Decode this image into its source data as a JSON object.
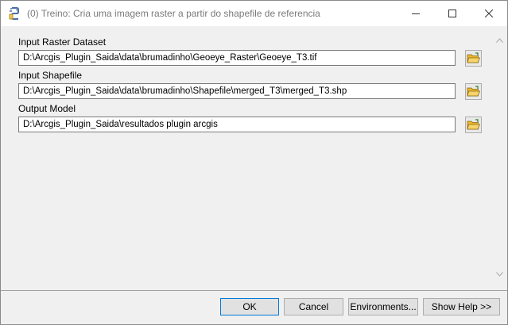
{
  "window": {
    "title": "(0) Treino: Cria uma imagem raster a partir do shapefile de referencia"
  },
  "fields": [
    {
      "label": "Input Raster Dataset",
      "value": "D:\\Arcgis_Plugin_Saida\\data\\brumadinho\\Geoeye_Raster\\Geoeye_T3.tif"
    },
    {
      "label": "Input Shapefile",
      "value": "D:\\Arcgis_Plugin_Saida\\data\\brumadinho\\Shapefile\\merged_T3\\merged_T3.shp"
    },
    {
      "label": "Output Model",
      "value": "D:\\Arcgis_Plugin_Saida\\resultados plugin arcgis"
    }
  ],
  "buttons": {
    "ok": "OK",
    "cancel": "Cancel",
    "environments": "Environments...",
    "show_help": "Show Help >>"
  },
  "icons": {
    "app": "python-script-icon",
    "browse": "open-folder-icon"
  },
  "colors": {
    "dialog_bg": "#f0f0f0",
    "default_button_border": "#0078d7",
    "folder_yellow": "#f2c84b"
  }
}
